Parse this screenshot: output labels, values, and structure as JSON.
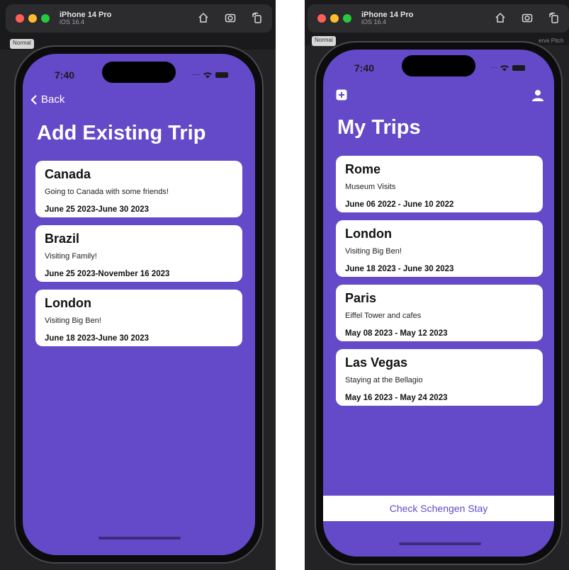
{
  "simulator": {
    "device_name": "iPhone 14 Pro",
    "os_version": "iOS 16.4",
    "scale_label": "Normal",
    "ghost_label": "erve Pitch"
  },
  "left_screen": {
    "time": "7:40",
    "back_label": "Back",
    "title": "Add Existing Trip",
    "trips": [
      {
        "name": "Canada",
        "description": "Going to Canada with some friends!",
        "dates": "June 25 2023-June 30 2023"
      },
      {
        "name": "Brazil",
        "description": "Visiting Family!",
        "dates": "June 25 2023-November 16 2023"
      },
      {
        "name": "London",
        "description": "Visiting Big Ben!",
        "dates": "June 18 2023-June 30 2023"
      }
    ]
  },
  "right_screen": {
    "time": "7:40",
    "title": "My Trips",
    "trips": [
      {
        "name": "Rome",
        "description": "Museum Visits",
        "dates": "June 06 2022 - June 10 2022"
      },
      {
        "name": "London",
        "description": "Visiting Big Ben!",
        "dates": "June 18 2023 - June 30 2023"
      },
      {
        "name": "Paris",
        "description": "Eiffel Tower and cafes",
        "dates": "May 08 2023 - May 12 2023"
      },
      {
        "name": "Las Vegas",
        "description": "Staying at the Bellagio",
        "dates": "May 16 2023 - May 24 2023"
      }
    ],
    "bottom_button_label": "Check Schengen Stay"
  },
  "colors": {
    "app_background": "#6449c9",
    "card_background": "#ffffff",
    "accent_text": "#6449c9"
  },
  "icons": [
    "home-icon",
    "screenshot-icon",
    "rotate-icon",
    "back-chevron-icon",
    "add-square-icon",
    "person-icon",
    "wifi-icon",
    "battery-icon"
  ]
}
